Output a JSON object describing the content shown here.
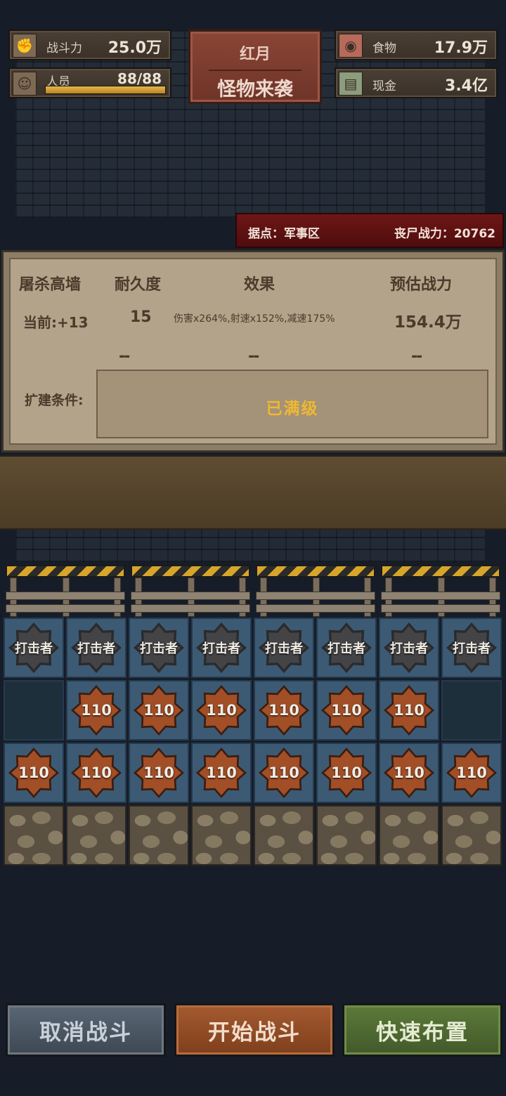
{
  "top_stats": {
    "combat": {
      "label": "战斗力",
      "value": "25.0万",
      "icon": "fist-icon"
    },
    "personnel": {
      "label": "人员",
      "value": "88/88",
      "icon": "person-icon",
      "fill": 1.0
    },
    "food": {
      "label": "食物",
      "value": "17.9万",
      "icon": "meat-icon"
    },
    "cash": {
      "label": "现金",
      "value": "3.4亿",
      "icon": "cash-icon"
    }
  },
  "event": {
    "line1": "红月",
    "line2": "怪物来袭"
  },
  "banner": {
    "location": "据点：军事区",
    "zombie_power": "丧尸战力：20762"
  },
  "panel": {
    "headers": [
      "屠杀高墙",
      "耐久度",
      "效果",
      "预估战力"
    ],
    "current": {
      "level": "当前:+13",
      "durability": "15",
      "effect": "伤害x264%,射速x152%,减速175%",
      "power": "154.4万"
    },
    "next": {
      "durability": "--",
      "effect": "--",
      "power": "--"
    },
    "condition_label": "扩建条件:",
    "condition_value": "已满级"
  },
  "grid": {
    "row1": [
      "打击者",
      "打击者",
      "打击者",
      "打击者",
      "打击者",
      "打击者",
      "打击者",
      "打击者"
    ],
    "row2": [
      "",
      "110",
      "110",
      "110",
      "110",
      "110",
      "110",
      ""
    ],
    "row3": [
      "110",
      "110",
      "110",
      "110",
      "110",
      "110",
      "110",
      "110"
    ]
  },
  "buttons": {
    "cancel": "取消战斗",
    "start": "开始战斗",
    "quick": "快速布置"
  },
  "colors": {
    "accent_gold": "#f0b830",
    "banner_red": "#6e1616",
    "slot_blue": "#3c5a74"
  }
}
